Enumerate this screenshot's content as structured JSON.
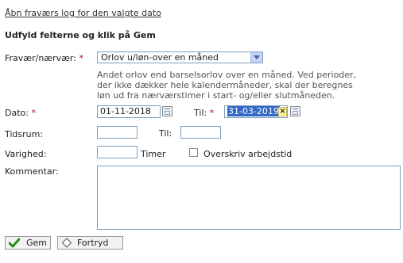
{
  "header": {
    "link_text": "Åbn fraværs log for den valgte dato",
    "instruction": "Udfyld felterne og klik på Gem"
  },
  "form": {
    "absence_label": "Fravær/nærvær:",
    "required_mark": "*",
    "absence_value": "Orlov u/løn-over en måned",
    "description": [
      "Andet orlov end barselsorlov over en måned. Ved perioder,",
      "der ikke dækker hele kalendermåneder, skal der beregnes",
      "løn ud fra nærværstimer i start- og/eller slutmåneden."
    ],
    "date_label": "Dato:",
    "date_value": "01-11-2018",
    "to_label": "Til:",
    "to_value": "31-03-2019",
    "time_label": "Tidsrum:",
    "time_to_label": "Til:",
    "duration_label": "Varighed:",
    "duration_unit": "Timer",
    "override_label": "Overskriv arbejdstid",
    "comment_label": "Kommentar:"
  },
  "buttons": {
    "save_label": "Gem",
    "cancel_label": "Fortryd"
  },
  "colors": {
    "required": "#cc0000",
    "selection": "#3068c8",
    "border": "#7f9db9"
  }
}
